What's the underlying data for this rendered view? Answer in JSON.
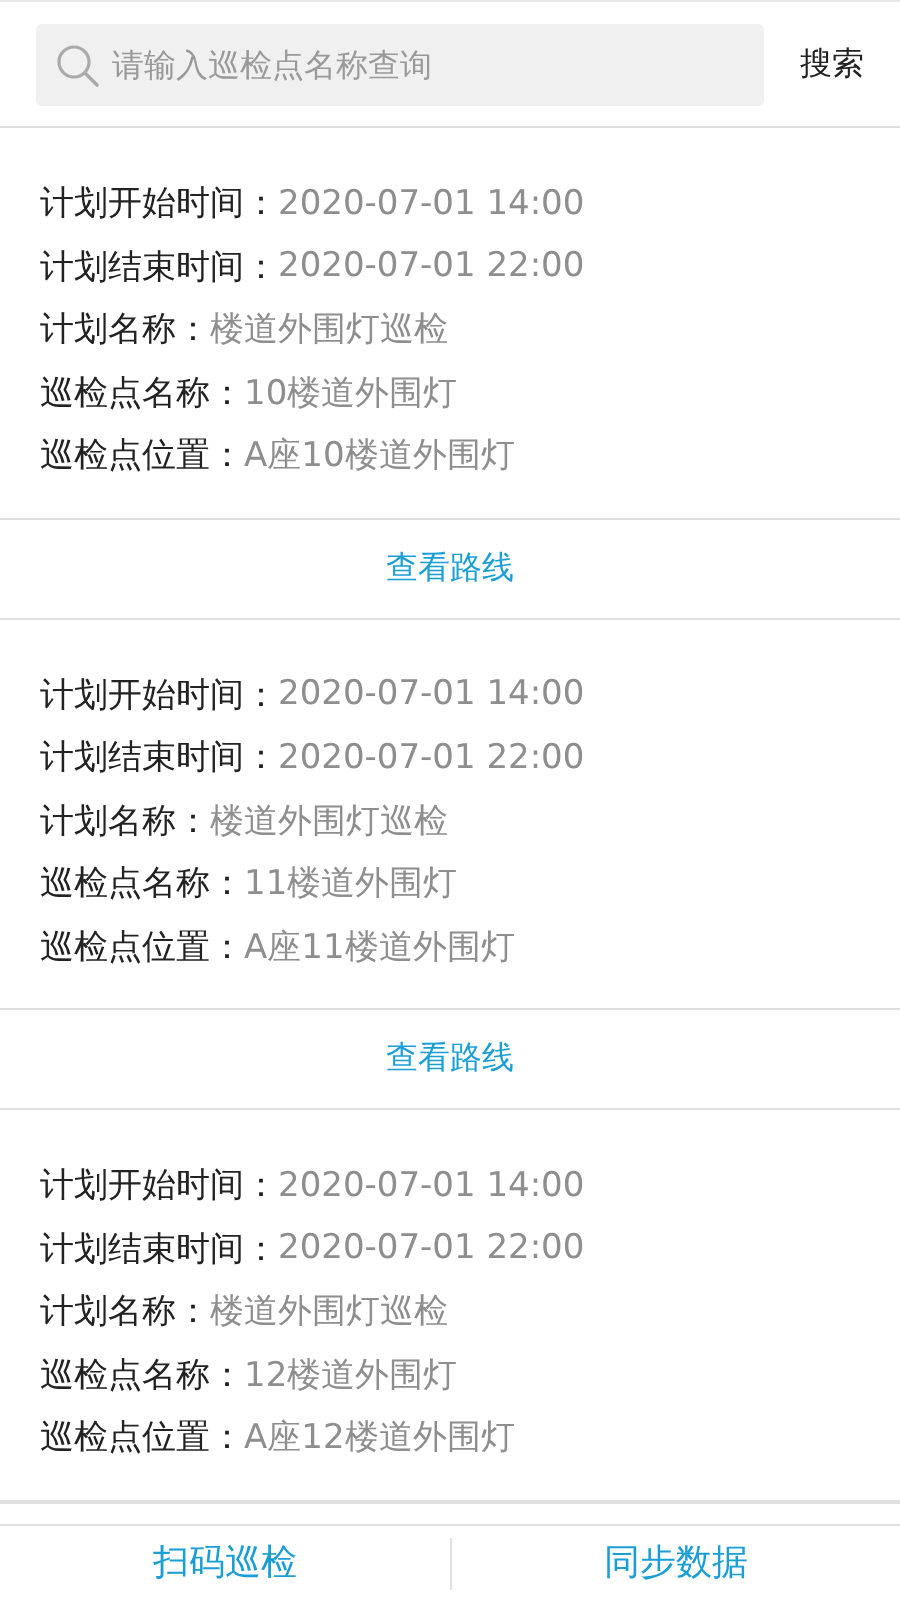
{
  "search": {
    "placeholder": "请输入巡检点名称查询",
    "button": "搜索"
  },
  "records": [
    {
      "fields": [
        {
          "label": "计划开始时间：",
          "value": "2020-07-01 14:00"
        },
        {
          "label": "计划结束时间：",
          "value": "2020-07-01 22:00"
        },
        {
          "label": "计划名称：",
          "value": "楼道外围灯巡检"
        },
        {
          "label": "巡检点名称：",
          "value": "10楼道外围灯"
        },
        {
          "label": "巡检点位置：",
          "value": "A座10楼道外围灯"
        }
      ],
      "route_link": "查看路线"
    },
    {
      "fields": [
        {
          "label": "计划开始时间：",
          "value": "2020-07-01 14:00"
        },
        {
          "label": "计划结束时间：",
          "value": "2020-07-01 22:00"
        },
        {
          "label": "计划名称：",
          "value": "楼道外围灯巡检"
        },
        {
          "label": "巡检点名称：",
          "value": "11楼道外围灯"
        },
        {
          "label": "巡检点位置：",
          "value": "A座11楼道外围灯"
        }
      ],
      "route_link": "查看路线"
    },
    {
      "fields": [
        {
          "label": "计划开始时间：",
          "value": "2020-07-01 14:00"
        },
        {
          "label": "计划结束时间：",
          "value": "2020-07-01 22:00"
        },
        {
          "label": "计划名称：",
          "value": "楼道外围灯巡检"
        },
        {
          "label": "巡检点名称：",
          "value": "12楼道外围灯"
        },
        {
          "label": "巡检点位置：",
          "value": "A座12楼道外围灯"
        }
      ]
    }
  ],
  "bottom_actions": [
    "扫码巡检",
    "同步数据"
  ]
}
